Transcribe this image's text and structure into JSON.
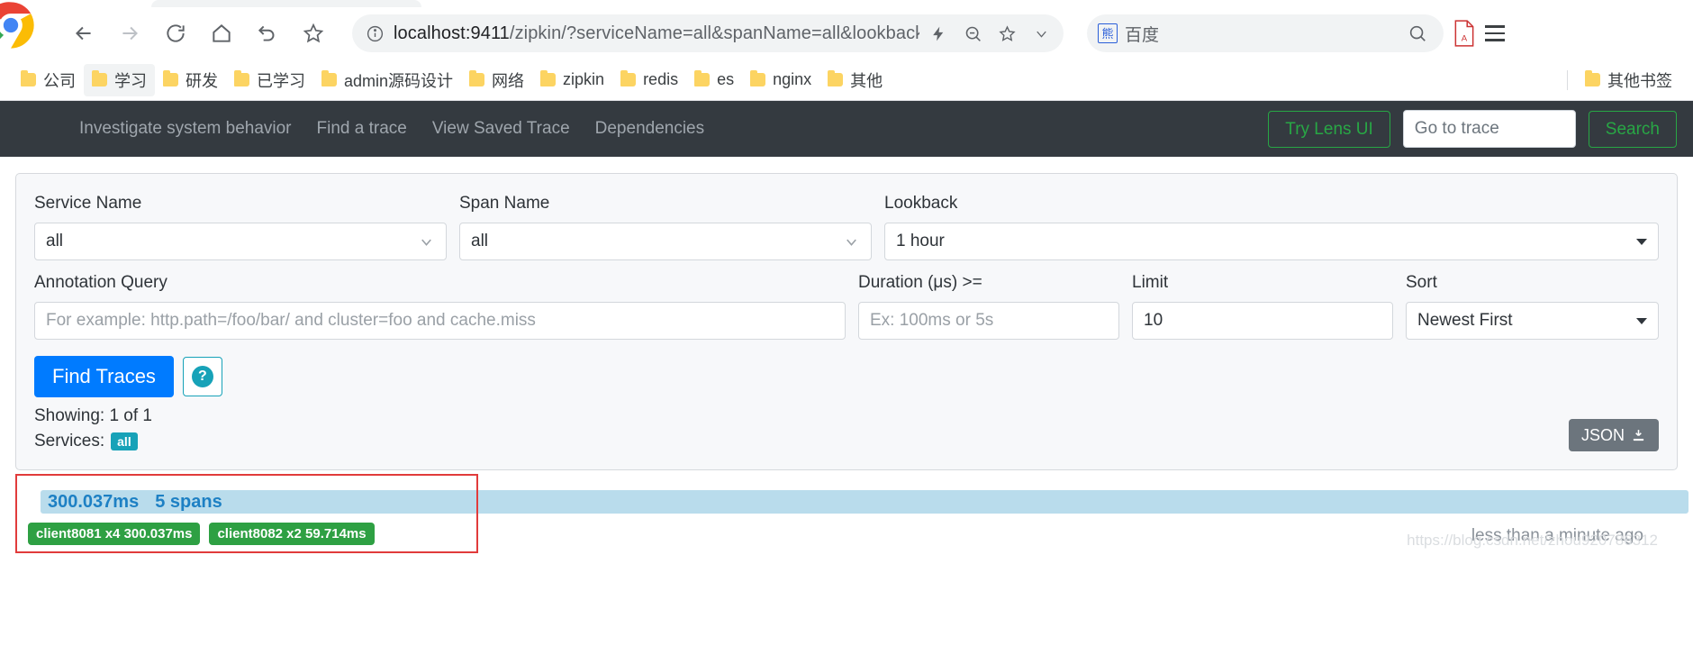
{
  "browser": {
    "nav": {
      "back_icon": "arrow-left-icon",
      "forward_icon": "arrow-right-icon",
      "reload_icon": "reload-icon",
      "home_icon": "home-icon",
      "history_icon": "history-back-icon",
      "bookmark_icon": "star-icon"
    },
    "omnibox": {
      "info_icon": "info-circle-icon",
      "url_host": "localhost:9411",
      "url_rest": "/zipkin/?serviceName=all&spanName=all&lookback=...",
      "full_url": "localhost:9411/zipkin/?serviceName=all&spanName=all&lookback=...",
      "icons": [
        "lightning-icon",
        "zoom-out-icon",
        "star-icon",
        "chevron-down-icon"
      ]
    },
    "search": {
      "engine_icon": "baidu-icon",
      "engine_label": "百度",
      "submit_icon": "search-icon"
    },
    "toolbar_right": {
      "pdf_icon": "pdf-icon",
      "menu_icon": "hamburger-menu-icon"
    },
    "bookmarks": [
      {
        "label": "公司",
        "icon": "folder-icon"
      },
      {
        "label": "学习",
        "icon": "folder-icon"
      },
      {
        "label": "研发",
        "icon": "folder-icon"
      },
      {
        "label": "已学习",
        "icon": "folder-icon"
      },
      {
        "label": "admin源码设计",
        "icon": "folder-icon"
      },
      {
        "label": "网络",
        "icon": "folder-icon"
      },
      {
        "label": "zipkin",
        "icon": "folder-icon"
      },
      {
        "label": "redis",
        "icon": "folder-icon"
      },
      {
        "label": "es",
        "icon": "folder-icon"
      },
      {
        "label": "nginx",
        "icon": "folder-icon"
      },
      {
        "label": "其他",
        "icon": "folder-icon"
      }
    ],
    "other_bookmarks": {
      "label": "其他书签",
      "icon": "folder-icon"
    }
  },
  "navbar": {
    "links": [
      {
        "label": "Investigate system behavior"
      },
      {
        "label": "Find a trace"
      },
      {
        "label": "View Saved Trace"
      },
      {
        "label": "Dependencies"
      }
    ],
    "try_lens_label": "Try Lens UI",
    "goto_trace_placeholder": "Go to trace",
    "goto_trace_value": "",
    "search_label": "Search"
  },
  "search_form": {
    "service_name": {
      "label": "Service Name",
      "value": "all",
      "chevron": "chevron-down-icon"
    },
    "span_name": {
      "label": "Span Name",
      "value": "all",
      "chevron": "chevron-down-icon"
    },
    "lookback": {
      "label": "Lookback",
      "value": "1 hour",
      "caret": "caret-down-icon"
    },
    "annotation_query": {
      "label": "Annotation Query",
      "value": "",
      "placeholder": "For example: http.path=/foo/bar/ and cluster=foo and cache.miss"
    },
    "duration": {
      "label": "Duration (μs) >=",
      "value": "",
      "placeholder": "Ex: 100ms or 5s"
    },
    "limit": {
      "label": "Limit",
      "value": "10"
    },
    "sort": {
      "label": "Sort",
      "value": "Newest First",
      "caret": "caret-down-icon"
    },
    "find_traces_label": "Find Traces",
    "help_icon": "question-mark-icon",
    "showing_text": "Showing: 1 of 1",
    "services_label": "Services:",
    "services_badge": "all",
    "json_label": "JSON",
    "json_icon": "download-icon"
  },
  "results": [
    {
      "duration": "300.037ms",
      "spans": "5 spans",
      "time_ago": "less than a minute ago",
      "service_badges": [
        "client8081 x4 300.037ms",
        "client8082 x2 59.714ms"
      ]
    }
  ],
  "watermark": "https://blog.csdn.net/zhou920786312",
  "colors": {
    "navbar_bg": "#343a40",
    "accent_green": "#28a745",
    "primary_blue": "#007bff",
    "badge_teal": "#17a2b8",
    "badge_green": "#2ea043",
    "duration_bar": "#b9dcec",
    "duration_text": "#1d80c4",
    "highlight_red": "#e13b3b",
    "json_gray": "#6c757d"
  }
}
